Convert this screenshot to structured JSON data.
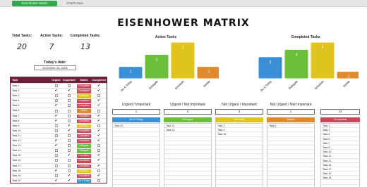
{
  "tabs": [
    {
      "label": "Eisenhower Matrix",
      "active": true
    },
    {
      "label": "Charts Data",
      "active": false
    }
  ],
  "title": "EISENHOWER MATRIX",
  "stats": {
    "total_label": "Total Tasks:",
    "total_value": "20",
    "active_label": "Active Tasks:",
    "active_value": "7",
    "completed_label": "Completed Tasks:",
    "completed_value": "13"
  },
  "today": {
    "label": "Today's date:",
    "value": "November 26, 2025"
  },
  "colors": {
    "do": "#3a8fd6",
    "delegate": "#6bbf3a",
    "schedule": "#e0c41e",
    "delete": "#e08a2e",
    "completed": "#c8475a",
    "header": "#6b1f3a"
  },
  "table": {
    "headers": [
      "Task",
      "Urgent",
      "Important",
      "Matrix",
      "Completed"
    ],
    "rows": [
      {
        "task": "Task 1",
        "urgent": false,
        "important": false,
        "matrix": "Completed",
        "completed": true
      },
      {
        "task": "Task 2",
        "urgent": true,
        "important": true,
        "matrix": "Completed",
        "completed": true
      },
      {
        "task": "Task 3",
        "urgent": false,
        "important": false,
        "matrix": "Schedule",
        "completed": false
      },
      {
        "task": "Task 4",
        "urgent": false,
        "important": false,
        "matrix": "Completed",
        "completed": true
      },
      {
        "task": "Task 5",
        "urgent": true,
        "important": false,
        "matrix": "Completed",
        "completed": true
      },
      {
        "task": "Task 6",
        "urgent": false,
        "important": false,
        "matrix": "Delete",
        "completed": false
      },
      {
        "task": "Task 7",
        "urgent": true,
        "important": false,
        "matrix": "Completed",
        "completed": true
      },
      {
        "task": "Task 8",
        "urgent": true,
        "important": false,
        "matrix": "Completed",
        "completed": true
      },
      {
        "task": "Task 9",
        "urgent": false,
        "important": true,
        "matrix": "Schedule",
        "completed": false
      },
      {
        "task": "Task 10",
        "urgent": false,
        "important": true,
        "matrix": "Completed",
        "completed": true
      },
      {
        "task": "Task 11",
        "urgent": false,
        "important": false,
        "matrix": "Completed",
        "completed": true
      },
      {
        "task": "Task 12",
        "urgent": true,
        "important": false,
        "matrix": "Completed",
        "completed": true
      },
      {
        "task": "Task 13",
        "urgent": true,
        "important": false,
        "matrix": "Delegate",
        "completed": false
      },
      {
        "task": "Task 14",
        "urgent": false,
        "important": false,
        "matrix": "Delegate",
        "completed": false
      },
      {
        "task": "Task 15",
        "urgent": false,
        "important": true,
        "matrix": "Completed",
        "completed": true
      },
      {
        "task": "Task 16",
        "urgent": false,
        "important": false,
        "matrix": "Completed",
        "completed": true
      },
      {
        "task": "Task 17",
        "urgent": false,
        "important": false,
        "matrix": "Completed",
        "completed": true
      },
      {
        "task": "Task 18",
        "urgent": true,
        "important": false,
        "matrix": "Schedule",
        "completed": false
      },
      {
        "task": "Task 19",
        "urgent": false,
        "important": true,
        "matrix": "Completed",
        "completed": true
      },
      {
        "task": "Task 20",
        "urgent": true,
        "important": true,
        "matrix": "Do It Today",
        "completed": false
      }
    ]
  },
  "chart_data": [
    {
      "type": "bar",
      "title": "Active Tasks",
      "categories": [
        "Do It Today",
        "Delegate",
        "Schedule",
        "Delete"
      ],
      "values": [
        1,
        2,
        3,
        1
      ],
      "colors": [
        "#3a8fd6",
        "#6bbf3a",
        "#e0c41e",
        "#e08a2e"
      ],
      "data_labels": [
        "1",
        "2",
        "3",
        "1"
      ]
    },
    {
      "type": "bar",
      "title": "Completed Tasks",
      "categories": [
        "Do It Today",
        "Delegate",
        "Schedule",
        "Delete"
      ],
      "values": [
        3,
        4,
        5,
        1
      ],
      "colors": [
        "#3a8fd6",
        "#6bbf3a",
        "#e0c41e",
        "#e08a2e"
      ],
      "data_labels": [
        "3",
        "4",
        "5",
        "1"
      ]
    }
  ],
  "columns": [
    {
      "title": "Urgent / Important",
      "count": "1",
      "banner": "Do It Today",
      "color": "#3a8fd6",
      "items": [
        "Task 20"
      ]
    },
    {
      "title": "Urgent / Not Important",
      "count": "2",
      "banner": "Delegate",
      "color": "#6bbf3a",
      "items": [
        "Task 13",
        "Task 14"
      ]
    },
    {
      "title": "Not Urgent / Important",
      "count": "3",
      "banner": "Schedule",
      "color": "#e0c41e",
      "items": [
        "Task 3",
        "Task 9",
        "Task 15"
      ]
    },
    {
      "title": "Not Urgent / Not Important",
      "count": "1",
      "banner": "Delete",
      "color": "#e08a2e",
      "items": [
        "Task 6"
      ]
    },
    {
      "title": "",
      "count": "13",
      "banner": "Completed",
      "color": "#c8475a",
      "items": [
        "Task 1",
        "Task 2",
        "Task 4",
        "Task 5",
        "Task 7",
        "Task 8",
        "Task 10",
        "Task 11",
        "Task 12",
        "Task 16",
        "Task 17",
        "Task 19",
        "Task 16"
      ]
    }
  ]
}
